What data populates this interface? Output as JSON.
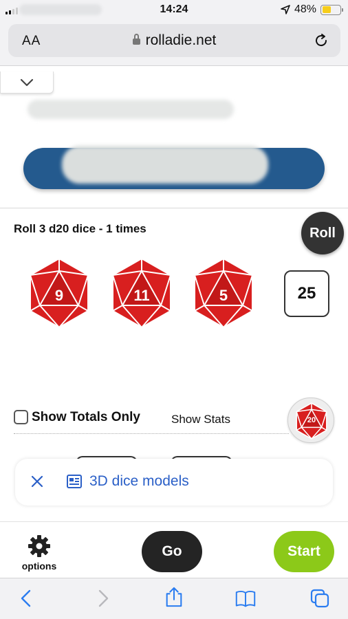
{
  "status_bar": {
    "time": "14:24",
    "battery_percent": "48%",
    "battery_level": 0.48,
    "location_icon": "location-arrow-icon"
  },
  "browser": {
    "text_size_label": "AA",
    "url": "rolladie.net",
    "lock_icon": "lock-icon",
    "reload_icon": "reload-icon"
  },
  "roller": {
    "title": "Roll 3 d20 dice - 1 times",
    "roll_button_label": "Roll",
    "dice": [
      {
        "value": "9",
        "color": "#d81f1f"
      },
      {
        "value": "11",
        "color": "#d81f1f"
      },
      {
        "value": "5",
        "color": "#d81f1f"
      }
    ],
    "total": "25"
  },
  "options_row": {
    "show_totals_only_label": "Show Totals Only",
    "show_totals_only_checked": false,
    "show_stats_label": "Show Stats",
    "die_type_label": "20"
  },
  "banner": {
    "text": "3D dice models",
    "text_color": "#2a5fc7"
  },
  "toolbar": {
    "options_label": "options",
    "go_label": "Go",
    "start_label": "Start",
    "start_color": "#8cc919"
  },
  "safari_toolbar": {
    "icons": [
      "back-icon",
      "forward-icon",
      "share-icon",
      "bookmarks-icon",
      "tabs-icon"
    ]
  }
}
